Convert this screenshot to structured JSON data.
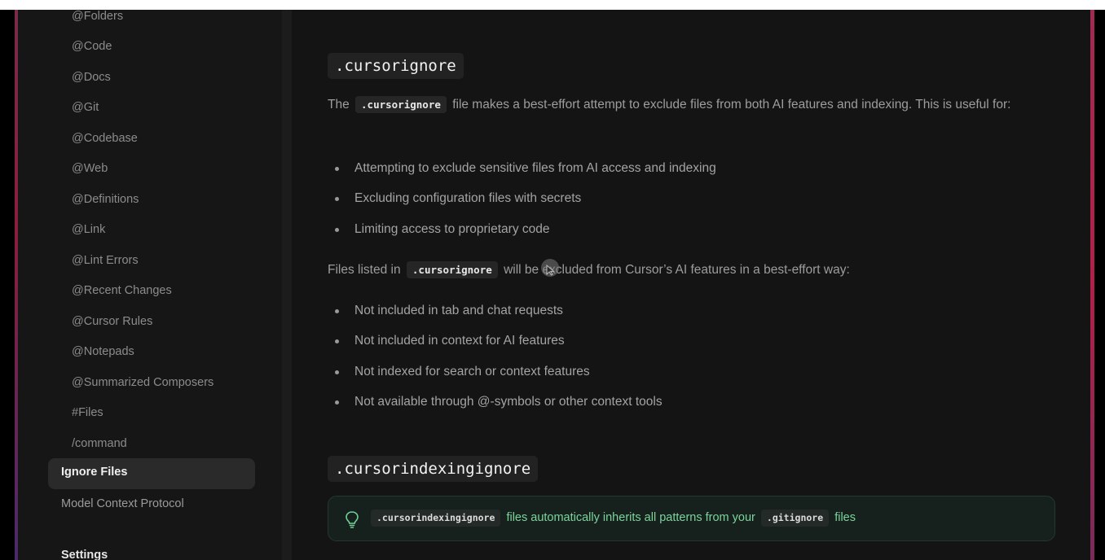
{
  "sidebar": {
    "items": [
      {
        "label": "@Folders"
      },
      {
        "label": "@Code"
      },
      {
        "label": "@Docs"
      },
      {
        "label": "@Git"
      },
      {
        "label": "@Codebase"
      },
      {
        "label": "@Web"
      },
      {
        "label": "@Definitions"
      },
      {
        "label": "@Link"
      },
      {
        "label": "@Lint Errors"
      },
      {
        "label": "@Recent Changes"
      },
      {
        "label": "@Cursor Rules"
      },
      {
        "label": "@Notepads"
      },
      {
        "label": "@Summarized Composers"
      },
      {
        "label": "#Files"
      },
      {
        "label": "/command"
      }
    ],
    "active_item": "Ignore Files",
    "next_item": "Model Context Protocol",
    "section_heading": "Settings"
  },
  "content": {
    "section1": {
      "heading": ".cursorignore",
      "intro_before": "The",
      "intro_code": ".cursorignore",
      "intro_after": "file makes a best-effort attempt to exclude files from both AI features and indexing. This is useful for:",
      "bullets": [
        "Attempting to exclude sensitive files from AI access and indexing",
        "Excluding configuration files with secrets",
        "Limiting access to proprietary code"
      ],
      "listed_before": "Files listed in",
      "listed_code": ".cursorignore",
      "listed_after": "will be excluded from Cursor’s AI features in a best-effort way:",
      "bullets2": [
        "Not included in tab and chat requests",
        "Not included in context for AI features",
        "Not indexed for search or context features",
        "Not available through @-symbols or other context tools"
      ]
    },
    "section2": {
      "heading": ".cursorindexingignore",
      "tip": {
        "icon": "lightbulb-icon",
        "code1": ".cursorindexingignore",
        "text": "files automatically inherits all patterns from your",
        "code2": ".gitignore",
        "text_end": "files"
      }
    }
  },
  "colors": {
    "background": "#141414",
    "tip_text": "#7cd49c",
    "active_bg": "#2a2a2a"
  }
}
